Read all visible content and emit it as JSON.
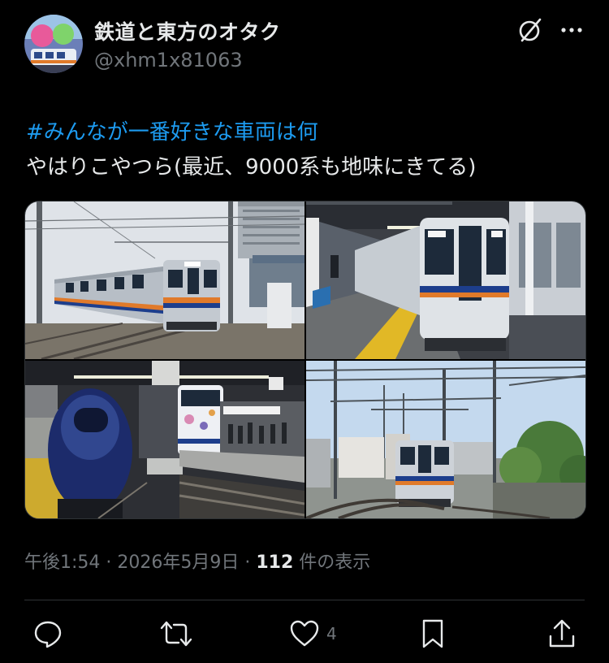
{
  "author": {
    "display_name": "鉄道と東方のオタク",
    "handle": "@xhm1x81063"
  },
  "post": {
    "hashtag": "#みんなが一番好きな車両は何",
    "text": "やはりこやつら(最近、9000系も地味にきてる)"
  },
  "media": {
    "count": 4,
    "colors": {
      "sky": "#dfe4ea",
      "train_body": "#b7bec6",
      "stripe_orange": "#e07a2a",
      "stripe_blue": "#1d3e8c",
      "rapit_navy": "#1c2b6b"
    }
  },
  "meta": {
    "time": "午後1:54",
    "separator": " · ",
    "date": "2026年5月9日",
    "views_count": "112",
    "views_label": " 件の表示"
  },
  "actions": {
    "like_count": "4"
  },
  "icons": [
    "grok-icon",
    "more-icon",
    "reply-icon",
    "repost-icon",
    "like-icon",
    "bookmark-icon",
    "share-icon"
  ],
  "colors": {
    "background": "#000000",
    "text": "#e7e9ea",
    "secondary": "#71767b",
    "link": "#1d9bf0",
    "divider": "#2f3336"
  }
}
